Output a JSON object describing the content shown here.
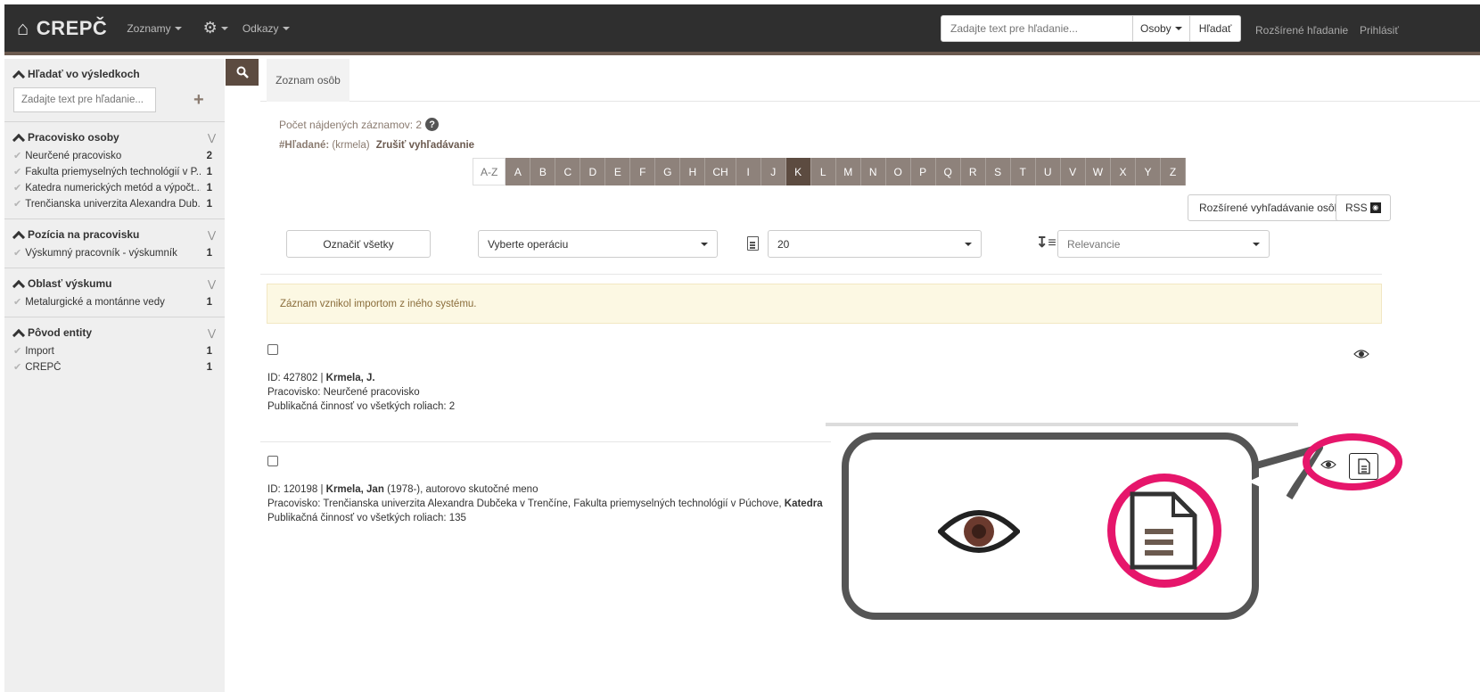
{
  "navbar": {
    "brand": "CREPČ",
    "menu": [
      {
        "label": "Zoznamy"
      },
      {
        "label": "Odkazy"
      }
    ],
    "search_placeholder": "Zadajte text pre hľadanie...",
    "search_type": "Osoby",
    "search_button": "Hľadať",
    "advanced_search": "Rozšírené hľadanie",
    "login": "Prihlásiť"
  },
  "sidebar": {
    "search": {
      "title": "Hľadať vo výsledkoch",
      "placeholder": "Zadajte text pre hľadanie..."
    },
    "facets": [
      {
        "title": "Pracovisko osoby",
        "items": [
          {
            "label": "Neurčené pracovisko",
            "count": "2"
          },
          {
            "label": "Fakulta priemyselných technológií v P...",
            "count": "1"
          },
          {
            "label": "Katedra numerických metód a výpočt...",
            "count": "1"
          },
          {
            "label": "Trenčianska univerzita Alexandra Dub...",
            "count": "1"
          }
        ]
      },
      {
        "title": "Pozícia na pracovisku",
        "items": [
          {
            "label": "Výskumný pracovník - výskumník",
            "count": "1"
          }
        ]
      },
      {
        "title": "Oblasť výskumu",
        "items": [
          {
            "label": "Metalurgické a montánne vedy",
            "count": "1"
          }
        ]
      },
      {
        "title": "Pôvod entity",
        "items": [
          {
            "label": "Import",
            "count": "1"
          },
          {
            "label": "CREPČ",
            "count": "1"
          }
        ]
      }
    ]
  },
  "main": {
    "tab": "Zoznam osôb",
    "count_label": "Počet nájdených záznamov: 2",
    "query_label": "#Hľadané:",
    "query_value": "(krmela)",
    "clear_search": "Zrušiť vyhľadávanie",
    "alphabet": [
      "A-Z",
      "A",
      "B",
      "C",
      "D",
      "E",
      "F",
      "G",
      "H",
      "CH",
      "I",
      "J",
      "K",
      "L",
      "M",
      "N",
      "O",
      "P",
      "Q",
      "R",
      "S",
      "T",
      "U",
      "V",
      "W",
      "X",
      "Y",
      "Z"
    ],
    "active_letter": "K",
    "advanced_person_search": "Rozšírené vyhľadávanie osôb",
    "rss": "RSS",
    "mark_all": "Označiť všetky",
    "operation_select": "Vyberte operáciu",
    "page_size": "20",
    "sort": "Relevancie",
    "notice": "Záznam vznikol importom z iného systému.",
    "records": [
      {
        "id_prefix": "ID: 427802 |",
        "name": "Krmela, J.",
        "name_suffix": "",
        "workplace_label": "Pracovisko: Neurčené pracovisko",
        "workplace_bold": "",
        "publications": "Publikačná činnosť vo všetkých roliach: 2"
      },
      {
        "id_prefix": "ID: 120198 |",
        "name": "Krmela, Jan",
        "name_suffix": "(1978-), autorovo skutočné meno",
        "workplace_label": "Pracovisko: Trenčianska univerzita Alexandra Dubčeka v Trenčíne, Fakulta priemyselných technológií v Púchove,",
        "workplace_bold": "Katedra numerick",
        "publications": "Publikačná činnosť vo všetkých roliach: 135"
      }
    ]
  },
  "colors": {
    "navbar_bg": "#2f2f2f",
    "accent_brown": "#5c4b40",
    "letter_bg": "#8e827b",
    "highlight_ring": "#e6166b",
    "notice_bg": "#fcf8e3"
  },
  "icons": [
    "home-icon",
    "gear-icon",
    "search-icon",
    "plus-icon",
    "chevron-up-icon",
    "double-chevron-down-icon",
    "check-icon",
    "question-icon",
    "rss-icon",
    "document-icon",
    "sort-icon",
    "eye-icon"
  ]
}
